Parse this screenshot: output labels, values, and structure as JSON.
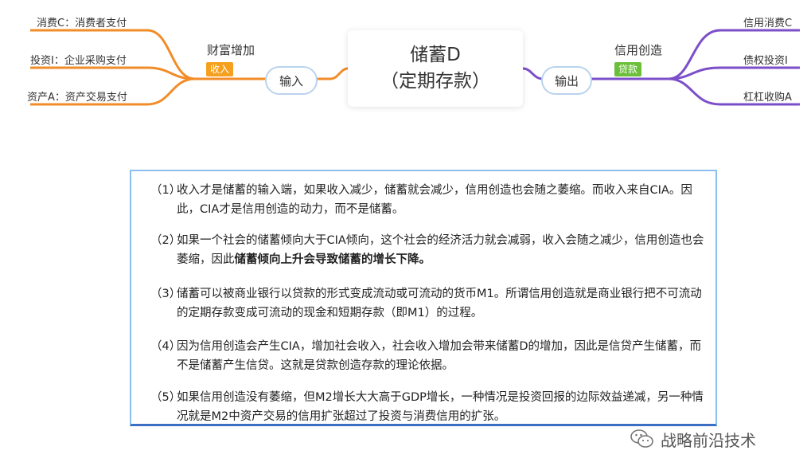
{
  "center": {
    "line1": "储蓄D",
    "line2": "（定期存款）"
  },
  "left": {
    "title": "财富增加",
    "tag": "收入",
    "pill": "输入",
    "leaves": [
      "消费C：消费者支付",
      "投资I：企业采购支付",
      "资产A：资产交易支付"
    ],
    "color": "#f28c28"
  },
  "right": {
    "title": "信用创造",
    "tag": "贷款",
    "pill": "输出",
    "leaves": [
      "信用消费C",
      "债权投资I",
      "杠杠收购A"
    ],
    "color": "#7b4fc9"
  },
  "notes": [
    {
      "num": "（1）",
      "text": "收入才是储蓄的输入端，如果收入减少，储蓄就会减少，信用创造也会随之萎缩。而收入来自CIA。因此，CIA才是信用创造的动力，而不是储蓄。"
    },
    {
      "num": "（2）",
      "text": "如果一个社会的储蓄倾向大于CIA倾向，这个社会的经济活力就会减弱，收入会随之减少，信用创造也会萎缩，因此",
      "bold": "储蓄倾向上升会导致储蓄的增长下降。"
    },
    {
      "num": "（3）",
      "text": "储蓄可以被商业银行以贷款的形式变成流动或可流动的货币M1。所谓信用创造就是商业银行把不可流动的定期存款变成可流动的现金和短期存款（即M1）的过程。"
    },
    {
      "num": "（4）",
      "text": "因为信用创造会产生CIA，增加社会收入，社会收入增加会带来储蓄D的增加，因此是信贷产生储蓄，而不是储蓄产生信贷。这就是贷款创造存款的理论依据。"
    },
    {
      "num": "（5）",
      "text": "如果信用创造没有萎缩，但M2增长大大高于GDP增长，一种情况是投资回报的边际效益递减，另一种情况就是M2中资产交易的信用扩张超过了投资与消费信用的扩张。"
    }
  ],
  "watermark": "战略前沿技术"
}
